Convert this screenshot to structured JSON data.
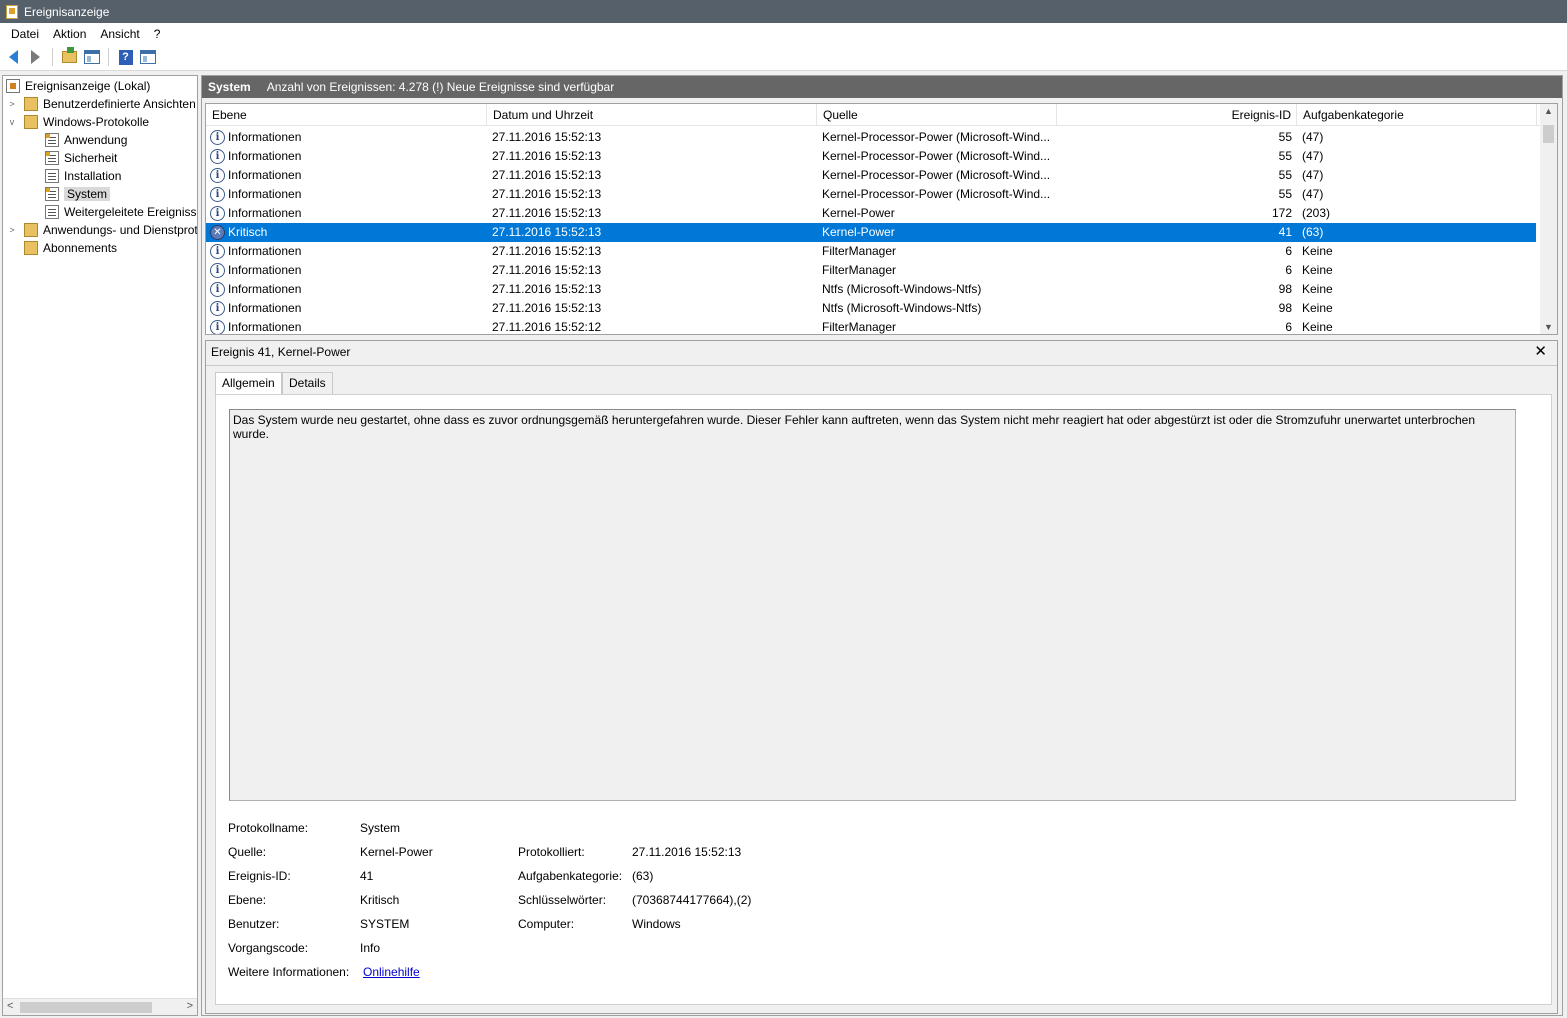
{
  "window": {
    "title": "Ereignisanzeige"
  },
  "menu": [
    "Datei",
    "Aktion",
    "Ansicht",
    "?"
  ],
  "toolbar": {
    "icons": [
      "back-arrow-icon",
      "forward-arrow-icon",
      "up-folder-icon",
      "show-hide-tree-icon",
      "help-icon",
      "action-pane-icon"
    ],
    "help_glyph": "?"
  },
  "tree": {
    "root": "Ereignisanzeige (Lokal)",
    "custom_views": "Benutzerdefinierte Ansichten",
    "windows_logs": "Windows-Protokolle",
    "application": "Anwendung",
    "security": "Sicherheit",
    "setup": "Installation",
    "system": "System",
    "forwarded": "Weitergeleitete Ereignisse",
    "app_services": "Anwendungs- und Dienstprotokolle",
    "subscriptions": "Abonnements"
  },
  "header": {
    "log_name": "System",
    "info": "Anzahl von Ereignissen: 4.278 (!) Neue Ereignisse sind verfügbar"
  },
  "columns": {
    "level": "Ebene",
    "datetime": "Datum und Uhrzeit",
    "source": "Quelle",
    "event_id": "Ereignis-ID",
    "task_category": "Aufgabenkategorie"
  },
  "level_glyphs": {
    "info": "i",
    "critical": "✕"
  },
  "events": [
    {
      "level": "Informationen",
      "type": "info",
      "datetime": "27.11.2016 15:52:13",
      "source": "Kernel-Processor-Power (Microsoft-Wind...",
      "id": "55",
      "category": "(47)"
    },
    {
      "level": "Informationen",
      "type": "info",
      "datetime": "27.11.2016 15:52:13",
      "source": "Kernel-Processor-Power (Microsoft-Wind...",
      "id": "55",
      "category": "(47)"
    },
    {
      "level": "Informationen",
      "type": "info",
      "datetime": "27.11.2016 15:52:13",
      "source": "Kernel-Processor-Power (Microsoft-Wind...",
      "id": "55",
      "category": "(47)"
    },
    {
      "level": "Informationen",
      "type": "info",
      "datetime": "27.11.2016 15:52:13",
      "source": "Kernel-Processor-Power (Microsoft-Wind...",
      "id": "55",
      "category": "(47)"
    },
    {
      "level": "Informationen",
      "type": "info",
      "datetime": "27.11.2016 15:52:13",
      "source": "Kernel-Power",
      "id": "172",
      "category": "(203)"
    },
    {
      "level": "Kritisch",
      "type": "critical",
      "datetime": "27.11.2016 15:52:13",
      "source": "Kernel-Power",
      "id": "41",
      "category": "(63)"
    },
    {
      "level": "Informationen",
      "type": "info",
      "datetime": "27.11.2016 15:52:13",
      "source": "FilterManager",
      "id": "6",
      "category": "Keine"
    },
    {
      "level": "Informationen",
      "type": "info",
      "datetime": "27.11.2016 15:52:13",
      "source": "FilterManager",
      "id": "6",
      "category": "Keine"
    },
    {
      "level": "Informationen",
      "type": "info",
      "datetime": "27.11.2016 15:52:13",
      "source": "Ntfs (Microsoft-Windows-Ntfs)",
      "id": "98",
      "category": "Keine"
    },
    {
      "level": "Informationen",
      "type": "info",
      "datetime": "27.11.2016 15:52:13",
      "source": "Ntfs (Microsoft-Windows-Ntfs)",
      "id": "98",
      "category": "Keine"
    },
    {
      "level": "Informationen",
      "type": "info",
      "datetime": "27.11.2016 15:52:12",
      "source": "FilterManager",
      "id": "6",
      "category": "Keine"
    }
  ],
  "detail": {
    "title": "Ereignis 41, Kernel-Power",
    "close": "✕",
    "tabs": {
      "general": "Allgemein",
      "details": "Details"
    },
    "message": "Das System wurde neu gestartet, ohne dass es zuvor ordnungsgemäß heruntergefahren wurde. Dieser Fehler kann auftreten, wenn das System nicht mehr reagiert hat oder abgestürzt ist oder die Stromzufuhr unerwartet unterbrochen wurde.",
    "labels": {
      "log_name": "Protokollname:",
      "source": "Quelle:",
      "event_id": "Ereignis-ID:",
      "level": "Ebene:",
      "user": "Benutzer:",
      "opcode": "Vorgangscode:",
      "more_info": "Weitere Informationen:",
      "logged": "Protokolliert:",
      "task_category": "Aufgabenkategorie:",
      "keywords": "Schlüsselwörter:",
      "computer": "Computer:"
    },
    "values": {
      "log_name": "System",
      "source": "Kernel-Power",
      "event_id": "41",
      "level": "Kritisch",
      "user": "SYSTEM",
      "opcode": "Info",
      "more_info_link": "Onlinehilfe",
      "logged": "27.11.2016 15:52:13",
      "task_category": "(63)",
      "keywords": "(70368744177664),(2)",
      "computer": "Windows"
    }
  }
}
